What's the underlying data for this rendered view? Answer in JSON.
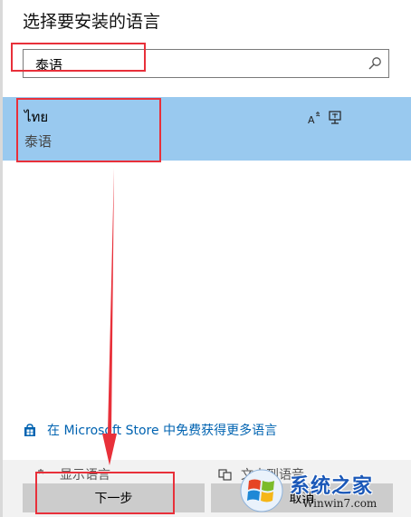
{
  "dialog": {
    "title": "选择要安装的语言"
  },
  "search": {
    "value": "泰语",
    "icon": "search-icon"
  },
  "language_list": {
    "items": [
      {
        "native_name": "ไทย",
        "localized_name": "泰语",
        "selected": true,
        "features": [
          "text-to-speech-icon",
          "display-language-icon"
        ]
      }
    ]
  },
  "store_link": {
    "label": "在 Microsoft Store 中免费获得更多语言",
    "icon": "store-bag-icon"
  },
  "options": {
    "display_language": "显示语言",
    "speech": "文本到语音"
  },
  "buttons": {
    "next": "下一步",
    "cancel": "取消"
  },
  "watermark": {
    "title": "系统之家",
    "url": "Winwin7.com"
  },
  "colors": {
    "selection": "#99c9ef",
    "link": "#0063b1",
    "button": "#cccccc",
    "annotation": "#e8303a",
    "watermark": "#1b58b8"
  }
}
